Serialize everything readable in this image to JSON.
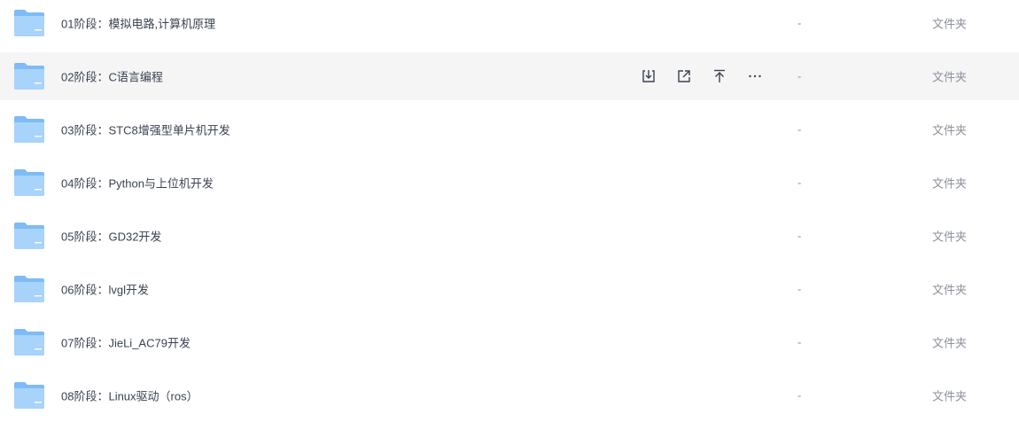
{
  "files": [
    {
      "name": "01阶段：模拟电路,计算机原理",
      "size": "-",
      "type": "文件夹"
    },
    {
      "name": "02阶段：C语言编程",
      "size": "-",
      "type": "文件夹"
    },
    {
      "name": "03阶段：STC8增强型单片机开发",
      "size": "-",
      "type": "文件夹"
    },
    {
      "name": "04阶段：Python与上位机开发",
      "size": "-",
      "type": "文件夹"
    },
    {
      "name": "05阶段：GD32开发",
      "size": "-",
      "type": "文件夹"
    },
    {
      "name": "06阶段：lvgl开发",
      "size": "-",
      "type": "文件夹"
    },
    {
      "name": "07阶段：JieLi_AC79开发",
      "size": "-",
      "type": "文件夹"
    },
    {
      "name": "08阶段：Linux驱动（ros）",
      "size": "-",
      "type": "文件夹"
    }
  ],
  "hovered_row_index": 1,
  "row_actions": [
    {
      "icon": "download-icon"
    },
    {
      "icon": "share-icon"
    },
    {
      "icon": "pin-top-icon"
    },
    {
      "icon": "more-icon"
    }
  ],
  "colors": {
    "hover_bg": "#f5f5f6",
    "folder_blue": "#7dbcf6",
    "folder_light": "#a8d3fb",
    "text_primary": "#3b4251",
    "text_secondary": "#8d929c"
  }
}
